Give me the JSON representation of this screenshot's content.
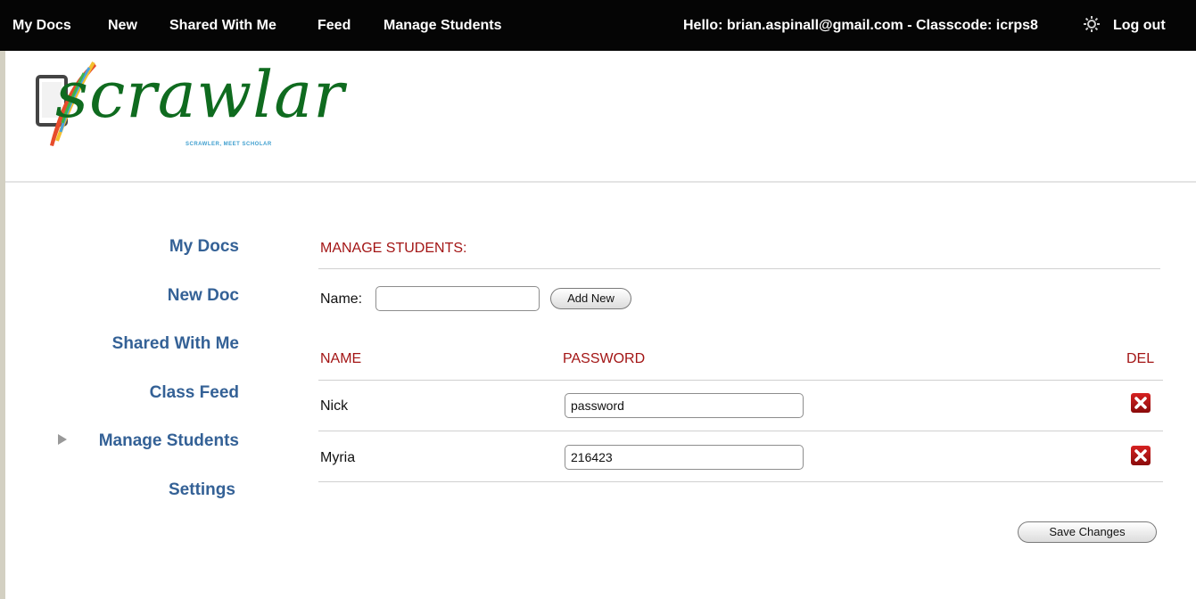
{
  "topbar": {
    "nav": [
      "My Docs",
      "New",
      "Shared With Me",
      "Feed",
      "Manage Students"
    ],
    "greeting": "Hello: brian.aspinall@gmail.com - Classcode: icrps8",
    "logout": "Log out"
  },
  "logo": {
    "wordmark": "scrawlar",
    "tagline": "SCRAWLER, MEET SCHOLAR"
  },
  "sidebar": {
    "items": [
      "My Docs",
      "New Doc",
      "Shared With Me",
      "Class Feed",
      "Manage Students",
      "Settings"
    ],
    "active": "Manage Students"
  },
  "main": {
    "title": "MANAGE STUDENTS:",
    "name_label": "Name:",
    "name_value": "",
    "add_button": "Add New",
    "columns": {
      "name": "NAME",
      "password": "PASSWORD",
      "del": "DEL"
    },
    "students": [
      {
        "name": "Nick",
        "password": "password"
      },
      {
        "name": "Myria",
        "password": "216423"
      }
    ],
    "save_button": "Save Changes"
  },
  "colors": {
    "topbar": "#050505",
    "accent_red": "#a31515",
    "link_blue": "#346196",
    "logo_green": "#0f6b1f",
    "delete_red": "#c41a1a"
  },
  "icons": [
    "gear-icon",
    "delete-icon",
    "active-arrow-icon",
    "tablet-icon",
    "quill-icon"
  ]
}
